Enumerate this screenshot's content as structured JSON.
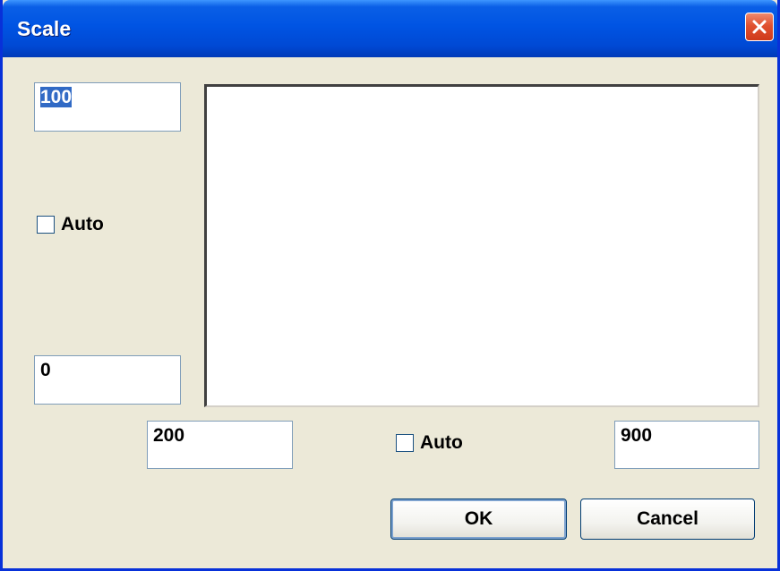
{
  "window": {
    "title": "Scale",
    "close_icon": "close-icon"
  },
  "y_axis": {
    "max_value": "100",
    "min_value": "0",
    "auto_label": "Auto",
    "auto_checked": false
  },
  "x_axis": {
    "min_value": "200",
    "max_value": "900",
    "auto_label": "Auto",
    "auto_checked": false
  },
  "buttons": {
    "ok_label": "OK",
    "cancel_label": "Cancel"
  },
  "colors": {
    "titlebar": "#0054e3",
    "close": "#e0512f",
    "dialog_bg": "#ece9d8",
    "selection": "#316ac5"
  }
}
